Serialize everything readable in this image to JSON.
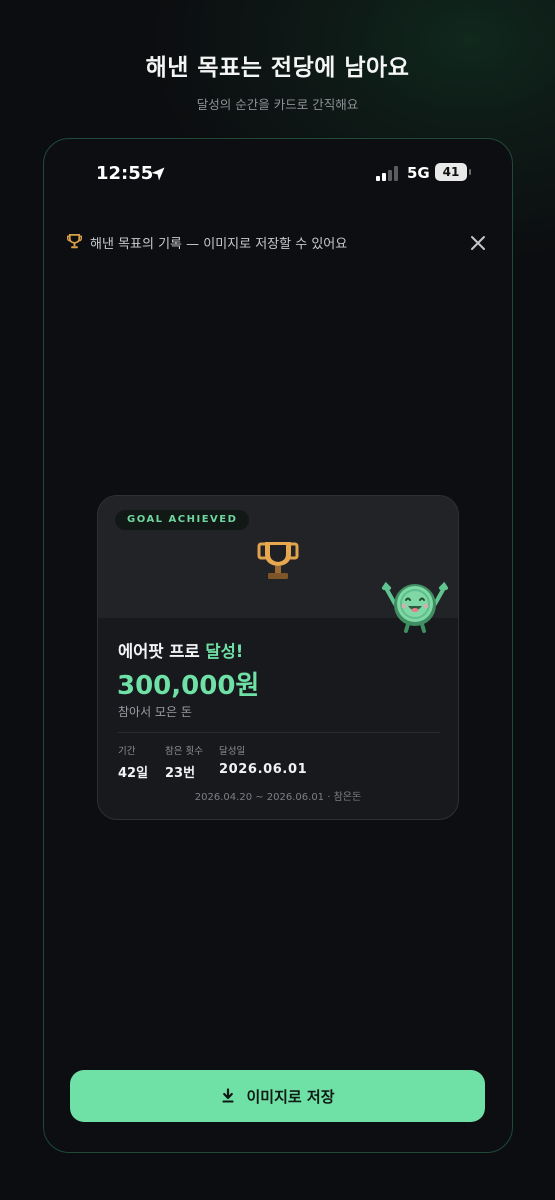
{
  "header": {
    "title": "해낸 목표는 전당에 남아요",
    "subtitle": "달성의 순간을 카드로 간직해요"
  },
  "status_bar": {
    "time": "12:55",
    "network": "5G",
    "battery": "41",
    "icons": [
      "location-arrow-icon",
      "signal-bars-icon",
      "battery-icon"
    ]
  },
  "notice": {
    "icon": "trophy-icon",
    "text": "해낸 목표의 기록 — 이미지로 저장할 수 있어요",
    "close_icon": "close-icon"
  },
  "card": {
    "badge": "GOAL ACHIEVED",
    "icon": "trophy-icon",
    "mascot": "coin-mascot-icon",
    "goal_name": "에어팟 프로",
    "goal_status": "달성!",
    "amount": "300,000원",
    "amount_caption": "참아서 모은 돈",
    "stats": [
      {
        "label": "기간",
        "value": "42일"
      },
      {
        "label": "참은 횟수",
        "value": "23번"
      },
      {
        "label": "달성일",
        "value": "2026.06.01"
      }
    ],
    "range": "2026.04.20 ~ 2026.06.01 · 참은돈"
  },
  "actions": {
    "save_label": "이미지로 저장",
    "save_icon": "download-icon"
  },
  "colors": {
    "accent": "#6fe0a6",
    "background": "#0c0d10",
    "trophy": "#d9a14a"
  }
}
